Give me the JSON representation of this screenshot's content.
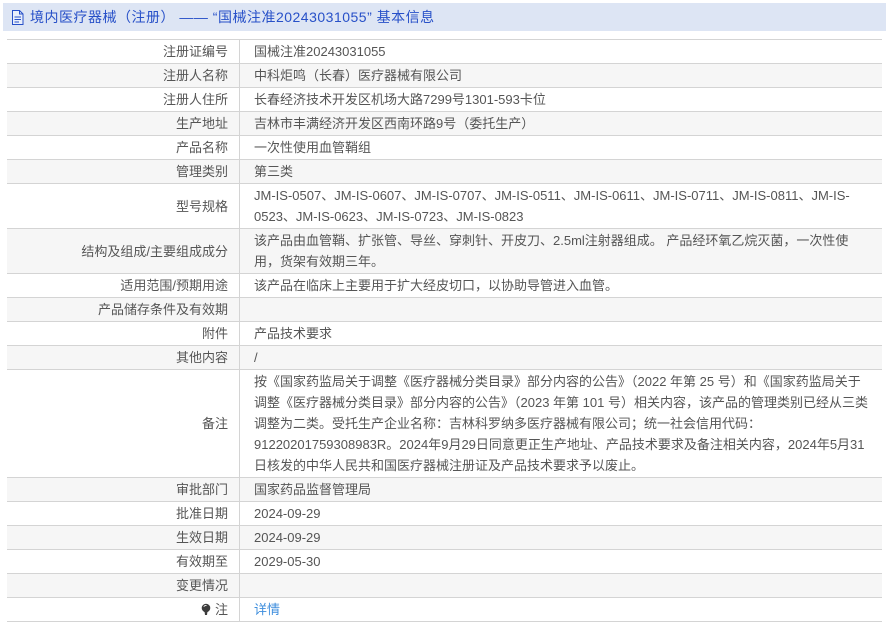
{
  "header": {
    "title": "境内医疗器械（注册） —— “国械注准20243031055” 基本信息",
    "bg": "#dde5f4",
    "text_color": "#2750c8",
    "icon": "document-icon"
  },
  "colors": {
    "link": "#3e8edd",
    "body_text": "#555555",
    "border": "#d4d4d4",
    "row_alt_bg": "#f6f6f6"
  },
  "table": {
    "rows": [
      {
        "label": "注册证编号",
        "value": "国械注准20243031055"
      },
      {
        "label": "注册人名称",
        "value": "中科炬鸣（长春）医疗器械有限公司"
      },
      {
        "label": "注册人住所",
        "value": "长春经济技术开发区机场大路7299号1301-593卡位"
      },
      {
        "label": "生产地址",
        "value": "吉林市丰满经济开发区西南环路9号（委托生产）"
      },
      {
        "label": "产品名称",
        "value": "一次性使用血管鞘组"
      },
      {
        "label": "管理类别",
        "value": "第三类"
      },
      {
        "label": "型号规格",
        "value": "JM-IS-0507、JM-IS-0607、JM-IS-0707、JM-IS-0511、JM-IS-0611、JM-IS-0711、JM-IS-0811、JM-IS-0523、JM-IS-0623、JM-IS-0723、JM-IS-0823"
      },
      {
        "label": "结构及组成/主要组成成分",
        "value": "该产品由血管鞘、扩张管、导丝、穿刺针、开皮刀、2.5ml注射器组成。 产品经环氧乙烷灭菌，一次性使用，货架有效期三年。"
      },
      {
        "label": "适用范围/预期用途",
        "value": "该产品在临床上主要用于扩大经皮切口，以协助导管进入血管。"
      },
      {
        "label": "产品储存条件及有效期",
        "value": ""
      },
      {
        "label": "附件",
        "value": "产品技术要求"
      },
      {
        "label": "其他内容",
        "value": "/"
      },
      {
        "label": "备注",
        "value": "按《国家药监局关于调整《医疗器械分类目录》部分内容的公告》（2022 年第 25 号）和《国家药监局关于调整《医疗器械分类目录》部分内容的公告》（2023 年第 101 号）相关内容，该产品的管理类别已经从三类调整为二类。受托生产企业名称：吉林科罗纳多医疗器械有限公司；统一社会信用代码：91220201759308983R。2024年9月29日同意更正生产地址、产品技术要求及备注相关内容，2024年5月31日核发的中华人民共和国医疗器械注册证及产品技术要求予以废止。"
      },
      {
        "label": "审批部门",
        "value": "国家药品监督管理局"
      },
      {
        "label": "批准日期",
        "value": "2024-09-29"
      },
      {
        "label": "生效日期",
        "value": "2024-09-29"
      },
      {
        "label": "有效期至",
        "value": "2029-05-30"
      },
      {
        "label": "变更情况",
        "value": ""
      },
      {
        "label": "注",
        "value": "详情",
        "value_type": "link",
        "label_icon": "note-bulb-icon"
      }
    ]
  }
}
